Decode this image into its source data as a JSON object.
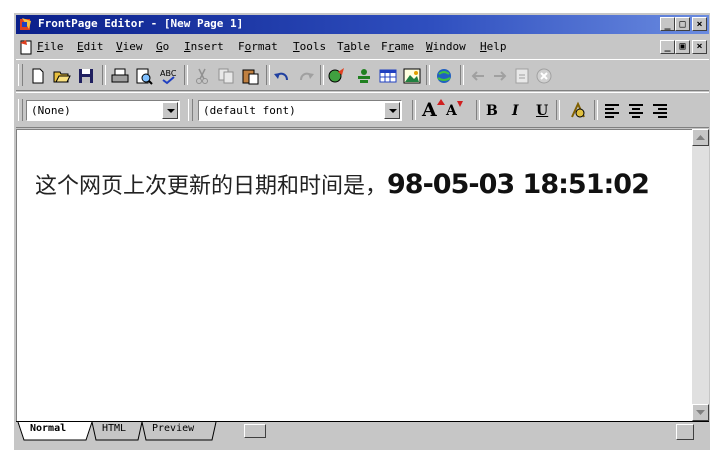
{
  "window": {
    "title": "FrontPage Editor - [New Page 1]",
    "controls": {
      "minimize": "_",
      "maximize": "□",
      "close": "×"
    }
  },
  "menu": {
    "items": [
      {
        "label": "File",
        "key": "F"
      },
      {
        "label": "Edit",
        "key": "E"
      },
      {
        "label": "View",
        "key": "V"
      },
      {
        "label": "Go",
        "key": "G"
      },
      {
        "label": "Insert",
        "key": "I"
      },
      {
        "label": "Format",
        "key": "o"
      },
      {
        "label": "Tools",
        "key": "T"
      },
      {
        "label": "Table",
        "key": "a"
      },
      {
        "label": "Frame",
        "key": "r"
      },
      {
        "label": "Window",
        "key": "W"
      },
      {
        "label": "Help",
        "key": "H"
      }
    ],
    "doc_controls": {
      "minimize": "_",
      "restore": "▣",
      "close": "×"
    }
  },
  "toolbar_standard": {
    "icons": [
      "new-page-icon",
      "open-icon",
      "save-icon",
      "print-icon",
      "print-preview-icon",
      "spelling-icon",
      "cut-icon",
      "copy-icon",
      "paste-icon",
      "undo-icon",
      "redo-icon",
      "webbot-icon",
      "form-field-icon",
      "table-icon",
      "image-icon",
      "hyperlink-icon",
      "back-icon",
      "forward-icon",
      "refresh-icon",
      "stop-icon"
    ]
  },
  "toolbar_format": {
    "style_value": "(None)",
    "font_value": "(default font)",
    "buttons": {
      "increase_font": "A",
      "decrease_font": "A",
      "bold": "B",
      "italic": "I",
      "underline": "U"
    }
  },
  "document": {
    "text_prefix": "这个网页上次更新的日期和时间是，",
    "timestamp": "98-05-03 18:51:02"
  },
  "tabs": [
    {
      "label": "Normal",
      "active": true
    },
    {
      "label": "HTML",
      "active": false
    },
    {
      "label": "Preview",
      "active": false
    }
  ],
  "colors": {
    "title_bar_start": "#0a1f8a",
    "title_bar_end": "#6a8be0",
    "chrome": "#c6c6c6"
  }
}
